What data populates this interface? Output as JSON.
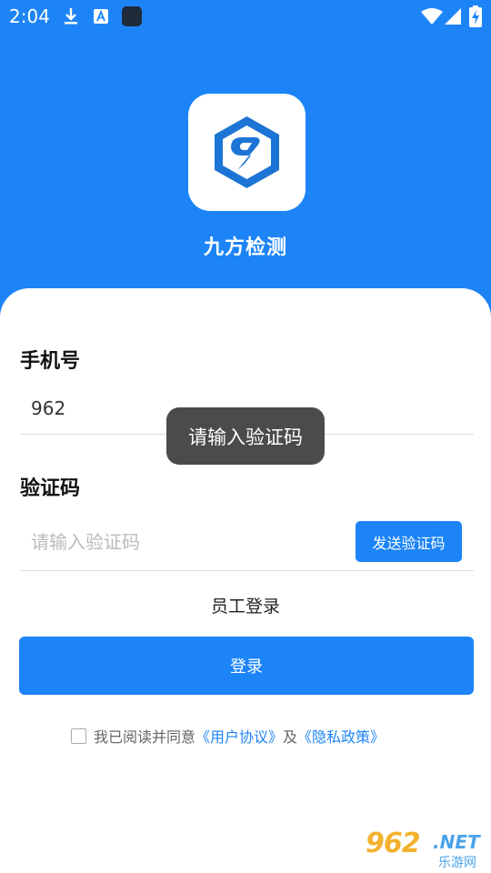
{
  "status_bar": {
    "time": "2:04",
    "icons": [
      "download-icon",
      "font-icon",
      "square-icon",
      "wifi-icon",
      "cellular-signal-icon",
      "battery-charging-icon"
    ]
  },
  "app": {
    "name": "九方检测",
    "logo_icon": "hexagon-9-logo-icon"
  },
  "form": {
    "phone_label": "手机号",
    "phone_value": "962",
    "code_label": "验证码",
    "code_placeholder": "请输入验证码",
    "send_code_label": "发送验证码",
    "staff_login_label": "员工登录",
    "login_label": "登录"
  },
  "agreement": {
    "prefix": "我已阅读并同意",
    "user_agreement": "《用户协议》",
    "and": "及",
    "privacy_policy": "《隐私政策》",
    "checked": false
  },
  "toast": {
    "message": "请输入验证码"
  },
  "watermark": {
    "number": "962",
    "suffix": ".NET",
    "subtitle": "乐游网"
  },
  "colors": {
    "primary": "#1C84F7",
    "toast_bg": "#3C3C3C"
  }
}
